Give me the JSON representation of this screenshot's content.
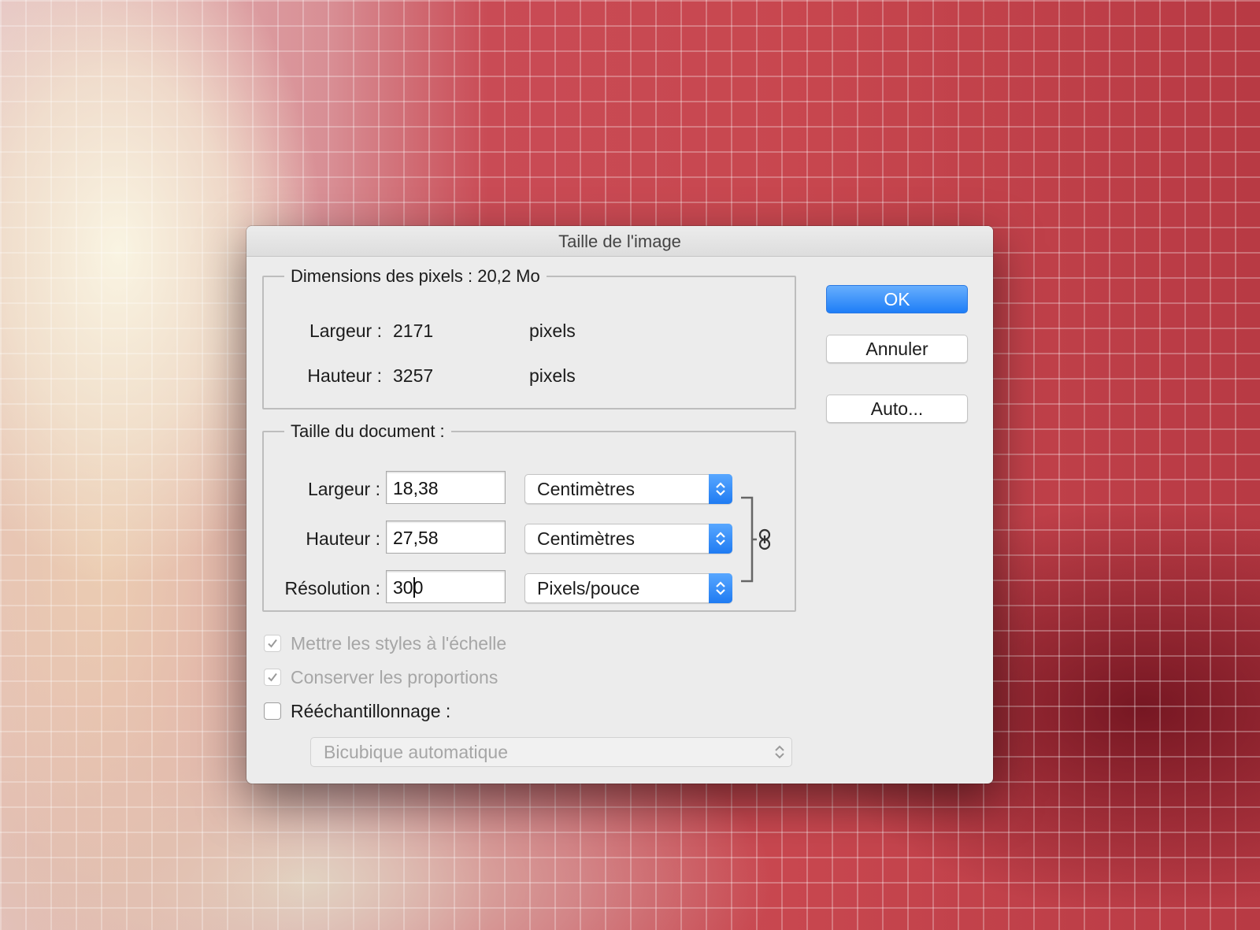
{
  "dialog": {
    "title": "Taille de l'image"
  },
  "pixel_dimensions": {
    "legend": "Dimensions des pixels : 20,2 Mo",
    "width_label": "Largeur :",
    "width_value": "2171",
    "width_unit": "pixels",
    "height_label": "Hauteur :",
    "height_value": "3257",
    "height_unit": "pixels"
  },
  "document_size": {
    "legend": "Taille du document :",
    "width_label": "Largeur :",
    "width_value": "18,38",
    "width_unit": "Centimètres",
    "height_label": "Hauteur :",
    "height_value": "27,58",
    "height_unit": "Centimètres",
    "resolution_label": "Résolution :",
    "resolution_value_before_caret": "30",
    "resolution_value_after_caret": "0",
    "resolution_unit": "Pixels/pouce",
    "proportions_linked": true
  },
  "buttons": {
    "ok": "OK",
    "cancel": "Annuler",
    "auto": "Auto..."
  },
  "options": {
    "scale_styles": {
      "label": "Mettre les styles à l'échelle",
      "checked": true,
      "enabled": false
    },
    "constrain_proportions": {
      "label": "Conserver les proportions",
      "checked": true,
      "enabled": false
    },
    "resample": {
      "label": "Rééchantillonnage :",
      "checked": false,
      "enabled": true
    },
    "resample_method": "Bicubique automatique"
  },
  "colors": {
    "accent": "#1e7ef7",
    "dialog_bg": "#ececec",
    "disabled_text": "#a6a6a6"
  },
  "icons": {
    "link": "chain-link-icon",
    "select_arrows": "chevron-up-down-icon",
    "checkmark": "checkmark-icon"
  }
}
